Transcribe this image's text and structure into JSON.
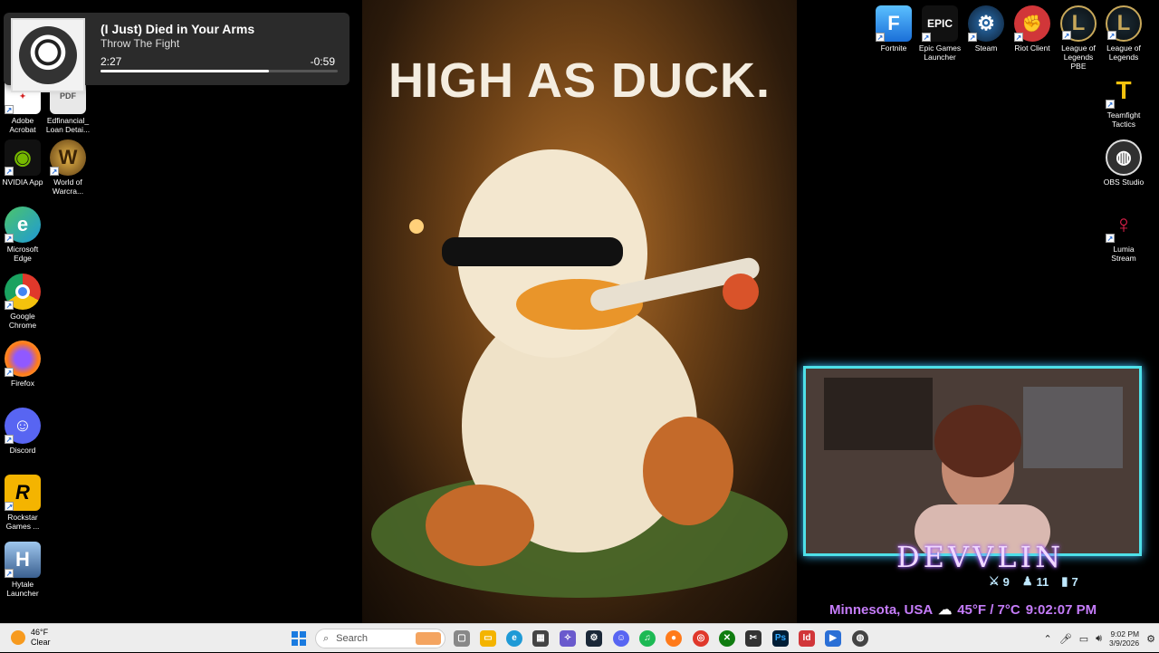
{
  "media": {
    "title": "(I Just) Died in Your Arms",
    "artist": "Throw The Fight",
    "elapsed": "2:27",
    "remaining": "-0:59",
    "progress": 0.71
  },
  "desktop_left": [
    {
      "label": "Adobe\nAcrobat",
      "icon": "acrobat-icon",
      "glyph": "✦",
      "color": "#d62020"
    },
    {
      "label": "Edfinancial_\nLoan Detai...",
      "icon": "pdf-file-icon",
      "glyph": "PDF",
      "color": "#e8e8e8"
    },
    {
      "label": "NVIDIA App",
      "icon": "nvidia-icon",
      "glyph": "◉",
      "color": "#76b900"
    },
    {
      "label": "World of\nWarcra...",
      "icon": "warcraft-icon",
      "glyph": "W",
      "color": "#5a3a12"
    },
    {
      "label": "Microsoft\nEdge",
      "icon": "edge-icon",
      "glyph": "e",
      "color": "#1f9ad6"
    },
    {
      "label": "Google\nChrome",
      "icon": "chrome-icon",
      "glyph": "◎",
      "color": "#e0382b"
    },
    {
      "label": "Firefox",
      "icon": "firefox-icon",
      "glyph": "🔥",
      "color": "#ff7a1a"
    },
    {
      "label": "Discord",
      "icon": "discord-icon",
      "glyph": "☺",
      "color": "#5865f2"
    },
    {
      "label": "Rockstar\nGames ...",
      "icon": "rockstar-icon",
      "glyph": "R",
      "color": "#f4b400"
    },
    {
      "label": "Hytale\nLauncher",
      "icon": "hytale-icon",
      "glyph": "H",
      "color": "#3a5f8f"
    }
  ],
  "desktop_right": [
    {
      "label": "Fortnite",
      "icon": "fortnite-icon",
      "glyph": "F",
      "color": "#2a8ef0"
    },
    {
      "label": "Epic Games\nLauncher",
      "icon": "epic-games-icon",
      "glyph": "EPIC",
      "color": "#1b1b1b"
    },
    {
      "label": "Steam",
      "icon": "steam-icon",
      "glyph": "⚙",
      "color": "#1b2838"
    },
    {
      "label": "Riot Client",
      "icon": "riot-icon",
      "glyph": "✊",
      "color": "#d13639"
    },
    {
      "label": "League of\nLegends PBE",
      "icon": "league-pbe-icon",
      "glyph": "L",
      "color": "#6b5a2a"
    },
    {
      "label": "League of\nLegends",
      "icon": "league-icon",
      "glyph": "L",
      "color": "#7a6530"
    },
    {
      "label": "Teamfight\nTactics",
      "icon": "tft-icon",
      "glyph": "T",
      "color": "#e0a800"
    },
    {
      "label": "OBS Studio",
      "icon": "obs-icon",
      "glyph": "◍",
      "color": "#303030"
    },
    {
      "label": "Lumia\nStream",
      "icon": "lumia-icon",
      "glyph": "♀",
      "color": "#d6204b"
    }
  ],
  "wallpaper": {
    "caption": "HIGH AS DUCK."
  },
  "overlay": {
    "name": "DEVVLIN",
    "stat1": "9",
    "stat2": "11",
    "stat3": "7",
    "location": "Minnesota, USA",
    "weather": "45°F / 7°C",
    "time": "9:02:07 PM"
  },
  "taskbar": {
    "temp": "46°F",
    "condition": "Clear",
    "search_placeholder": "Search",
    "time": "9:02 PM",
    "date": "3/9/2026"
  }
}
